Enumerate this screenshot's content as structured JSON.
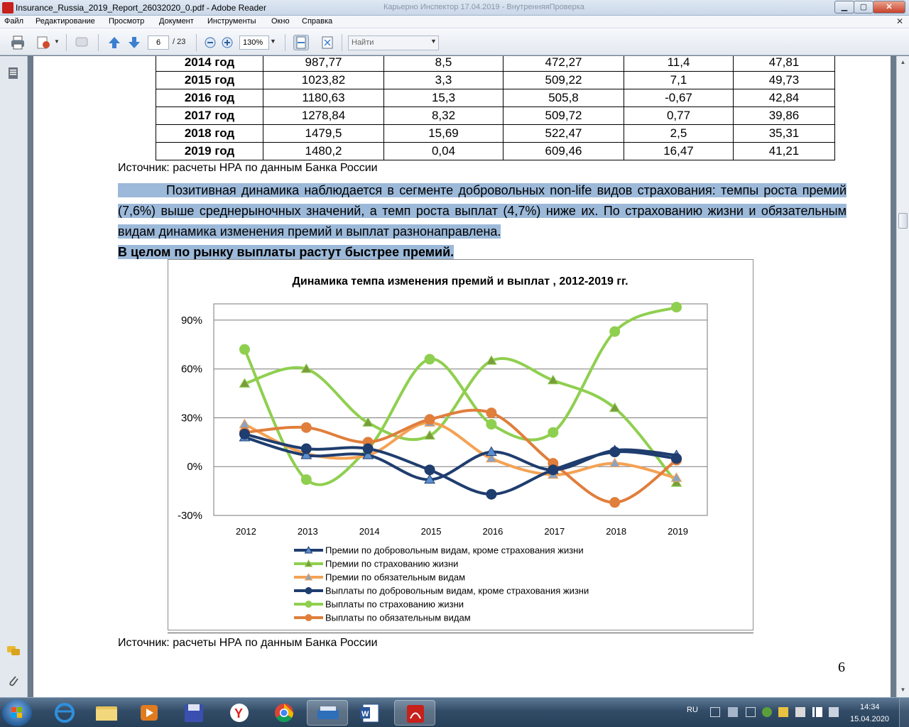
{
  "window": {
    "title": "Insurance_Russia_2019_Report_26032020_0.pdf - Adobe Reader",
    "background_title": "Карьерно Инспектор 17.04.2019 - ВнутренняяПроверка"
  },
  "menu": [
    "Файл",
    "Редактирование",
    "Просмотр",
    "Документ",
    "Инструменты",
    "Окно",
    "Справка"
  ],
  "toolbar": {
    "page_current": "6",
    "page_total": "/ 23",
    "zoom": "130%",
    "search_placeholder": "Найти"
  },
  "table": {
    "rows": [
      {
        "year": "2014 год",
        "c1": "987,77",
        "c2": "8,5",
        "c3": "472,27",
        "c4": "11,4",
        "c5": "47,81"
      },
      {
        "year": "2015 год",
        "c1": "1023,82",
        "c2": "3,3",
        "c3": "509,22",
        "c4": "7,1",
        "c5": "49,73"
      },
      {
        "year": "2016 год",
        "c1": "1180,63",
        "c2": "15,3",
        "c3": "505,8",
        "c4": "-0,67",
        "c5": "42,84"
      },
      {
        "year": "2017 год",
        "c1": "1278,84",
        "c2": "8,32",
        "c3": "509,72",
        "c4": "0,77",
        "c5": "39,86"
      },
      {
        "year": "2018 год",
        "c1": "1479,5",
        "c2": "15,69",
        "c3": "522,47",
        "c4": "2,5",
        "c5": "35,31"
      },
      {
        "year": "2019 год",
        "c1": "1480,2",
        "c2": "0,04",
        "c3": "609,46",
        "c4": "16,47",
        "c5": "41,21"
      }
    ]
  },
  "text": {
    "source_1": "Источник: расчеты НРА по данным Банка России",
    "para_1": "Позитивная динамика наблюдается в сегменте добровольных non-life видов страхования: темпы роста премий (7,6%) выше среднерыночных значений, а темп роста выплат (4,7%) ниже их. По страхованию жизни и обязательным видам динамика изменения премий и выплат разнонаправлена.",
    "para_1_bold": "В целом по рынку выплаты растут быстрее премий.",
    "source_2": "Источник: расчеты НРА по данным Банка России",
    "page_number": "6"
  },
  "chart_data": {
    "type": "line",
    "title": "Динамика темпа изменения премий и выплат , 2012-2019 гг.",
    "categories": [
      "2012",
      "2013",
      "2014",
      "2015",
      "2016",
      "2017",
      "2018",
      "2019"
    ],
    "ylim": [
      -30,
      100
    ],
    "yticks": [
      "-30%",
      "0%",
      "30%",
      "60%",
      "90%"
    ],
    "ytick_values": [
      -30,
      0,
      30,
      60,
      90
    ],
    "grid": true,
    "legend_position": "bottom",
    "series": [
      {
        "name": "Премии по добровольным видам, кроме страхования жизни",
        "values": [
          18,
          7,
          7,
          -8,
          9,
          -2,
          10,
          7
        ],
        "color": "#1f3d6e",
        "marker": "triangle",
        "marker_fill": "#5b8fd0"
      },
      {
        "name": "Премии по страхованию жизни",
        "values": [
          51,
          60,
          27,
          19,
          65,
          53,
          36,
          -10
        ],
        "color": "#8fcf4f",
        "marker": "triangle",
        "marker_fill": "#7a9c3c"
      },
      {
        "name": "Премии по обязательным видам",
        "values": [
          26,
          8,
          7,
          27,
          5,
          -5,
          2,
          -7
        ],
        "color": "#f4a254",
        "marker": "triangle",
        "marker_fill": "#8aa3c3"
      },
      {
        "name": "Выплаты по добровольным видам, кроме страхования жизни",
        "values": [
          20,
          11,
          11,
          -2,
          -17,
          -2,
          9,
          5
        ],
        "color": "#1f3d6e",
        "marker": "circle",
        "marker_fill": "#1f3d6e"
      },
      {
        "name": "Выплаты по страхованию жизни",
        "values": [
          72,
          -8,
          11,
          66,
          26,
          21,
          83,
          98
        ],
        "color": "#8fcf4f",
        "marker": "circle",
        "marker_fill": "#8fcf4f"
      },
      {
        "name": "Выплаты по обязательным видам",
        "values": [
          21,
          24,
          15,
          29,
          33,
          2,
          -22,
          4
        ],
        "color": "#e07e3c",
        "marker": "circle",
        "marker_fill": "#e07e3c"
      }
    ]
  },
  "taskbar": {
    "lang": "RU",
    "time": "14:34",
    "date": "15.04.2020"
  }
}
